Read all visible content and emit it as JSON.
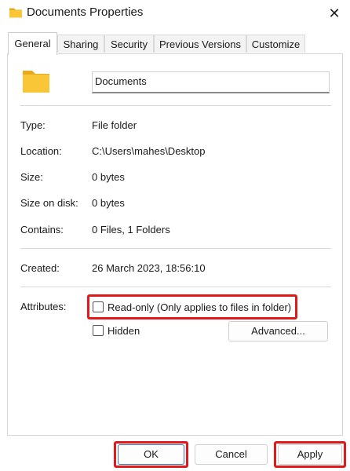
{
  "window": {
    "title": "Documents Properties",
    "close_glyph": "✕"
  },
  "tabs": [
    {
      "label": "General",
      "active": true
    },
    {
      "label": "Sharing",
      "active": false
    },
    {
      "label": "Security",
      "active": false
    },
    {
      "label": "Previous Versions",
      "active": false
    },
    {
      "label": "Customize",
      "active": false
    }
  ],
  "general": {
    "name_value": "Documents",
    "rows": {
      "type": {
        "label": "Type:",
        "value": "File folder"
      },
      "location": {
        "label": "Location:",
        "value": "C:\\Users\\mahes\\Desktop"
      },
      "size": {
        "label": "Size:",
        "value": "0 bytes"
      },
      "size_on_disk": {
        "label": "Size on disk:",
        "value": "0 bytes"
      },
      "contains": {
        "label": "Contains:",
        "value": "0 Files, 1 Folders"
      },
      "created": {
        "label": "Created:",
        "value": "26 March 2023, 18:56:10"
      }
    },
    "attributes": {
      "label": "Attributes:",
      "readonly": {
        "label": "Read-only (Only applies to files in folder)",
        "checked": false
      },
      "hidden": {
        "label": "Hidden",
        "checked": false
      },
      "advanced_label": "Advanced..."
    }
  },
  "footer": {
    "ok_label": "OK",
    "cancel_label": "Cancel",
    "apply_label": "Apply"
  },
  "colors": {
    "highlight": "#e01a1a",
    "folder": "#f8c637",
    "folder_dark": "#e7a91d"
  }
}
